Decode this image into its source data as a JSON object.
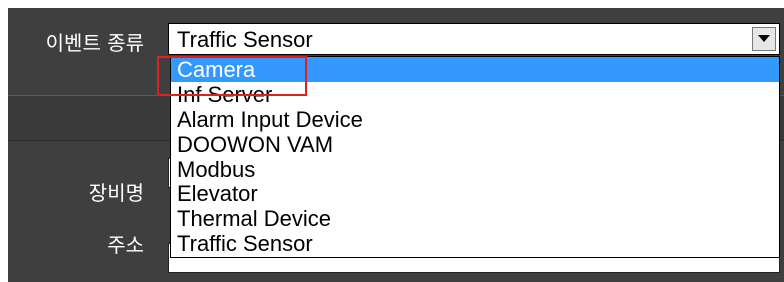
{
  "form": {
    "event_type_label": "이벤트 종류",
    "device_name_label": "장비명",
    "address_label": "주소",
    "event_type_selected": "Traffic Sensor"
  },
  "dropdown": {
    "options": [
      "Camera",
      "Inf Server",
      "Alarm Input Device",
      "DOOWON VAM",
      "Modbus",
      "Elevator",
      "Thermal Device",
      "Traffic Sensor"
    ],
    "highlighted": "Camera"
  },
  "colors": {
    "panel_bg": "#3f3f3f",
    "selection": "#3399ff",
    "annotation_box": "#e02020"
  },
  "icons": {
    "dropdown_arrow": "triangle-down-icon"
  }
}
